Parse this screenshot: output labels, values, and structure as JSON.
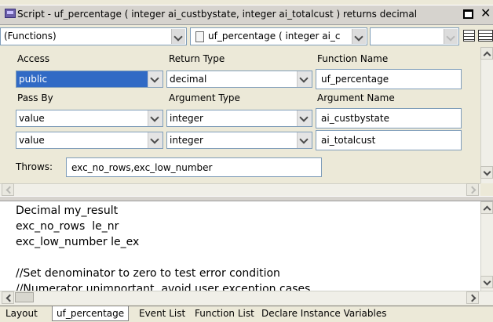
{
  "window": {
    "title": "Script - uf_percentage ( integer ai_custbystate, integer ai_totalcust ) returns decimal"
  },
  "toolbar": {
    "functions_combo": "(Functions)",
    "signature_combo": "uf_percentage ( integer ai_c"
  },
  "properties": {
    "access_label": "Access",
    "return_type_label": "Return Type",
    "function_name_label": "Function Name",
    "access_value": "public",
    "return_type_value": "decimal",
    "function_name_value": "uf_percentage",
    "pass_by_label": "Pass By",
    "argument_type_label": "Argument Type",
    "argument_name_label": "Argument Name",
    "arguments": [
      {
        "pass_by": "value",
        "type": "integer",
        "name": "ai_custbystate"
      },
      {
        "pass_by": "value",
        "type": "integer",
        "name": "ai_totalcust"
      }
    ],
    "throws_label": "Throws:",
    "throws_value": "exc_no_rows,exc_low_number"
  },
  "editor": {
    "lines": [
      "Decimal my_result",
      "exc_no_rows  le_nr",
      "exc_low_number le_ex",
      "",
      "//Set denominator to zero to test error condition",
      "//Numerator unimportant, avoid user exception cases"
    ]
  },
  "tabs": [
    {
      "label": "Layout"
    },
    {
      "label": "uf_percentage",
      "active": true
    },
    {
      "label": "Event List"
    },
    {
      "label": "Function List"
    },
    {
      "label": "Declare Instance Variables"
    }
  ]
}
